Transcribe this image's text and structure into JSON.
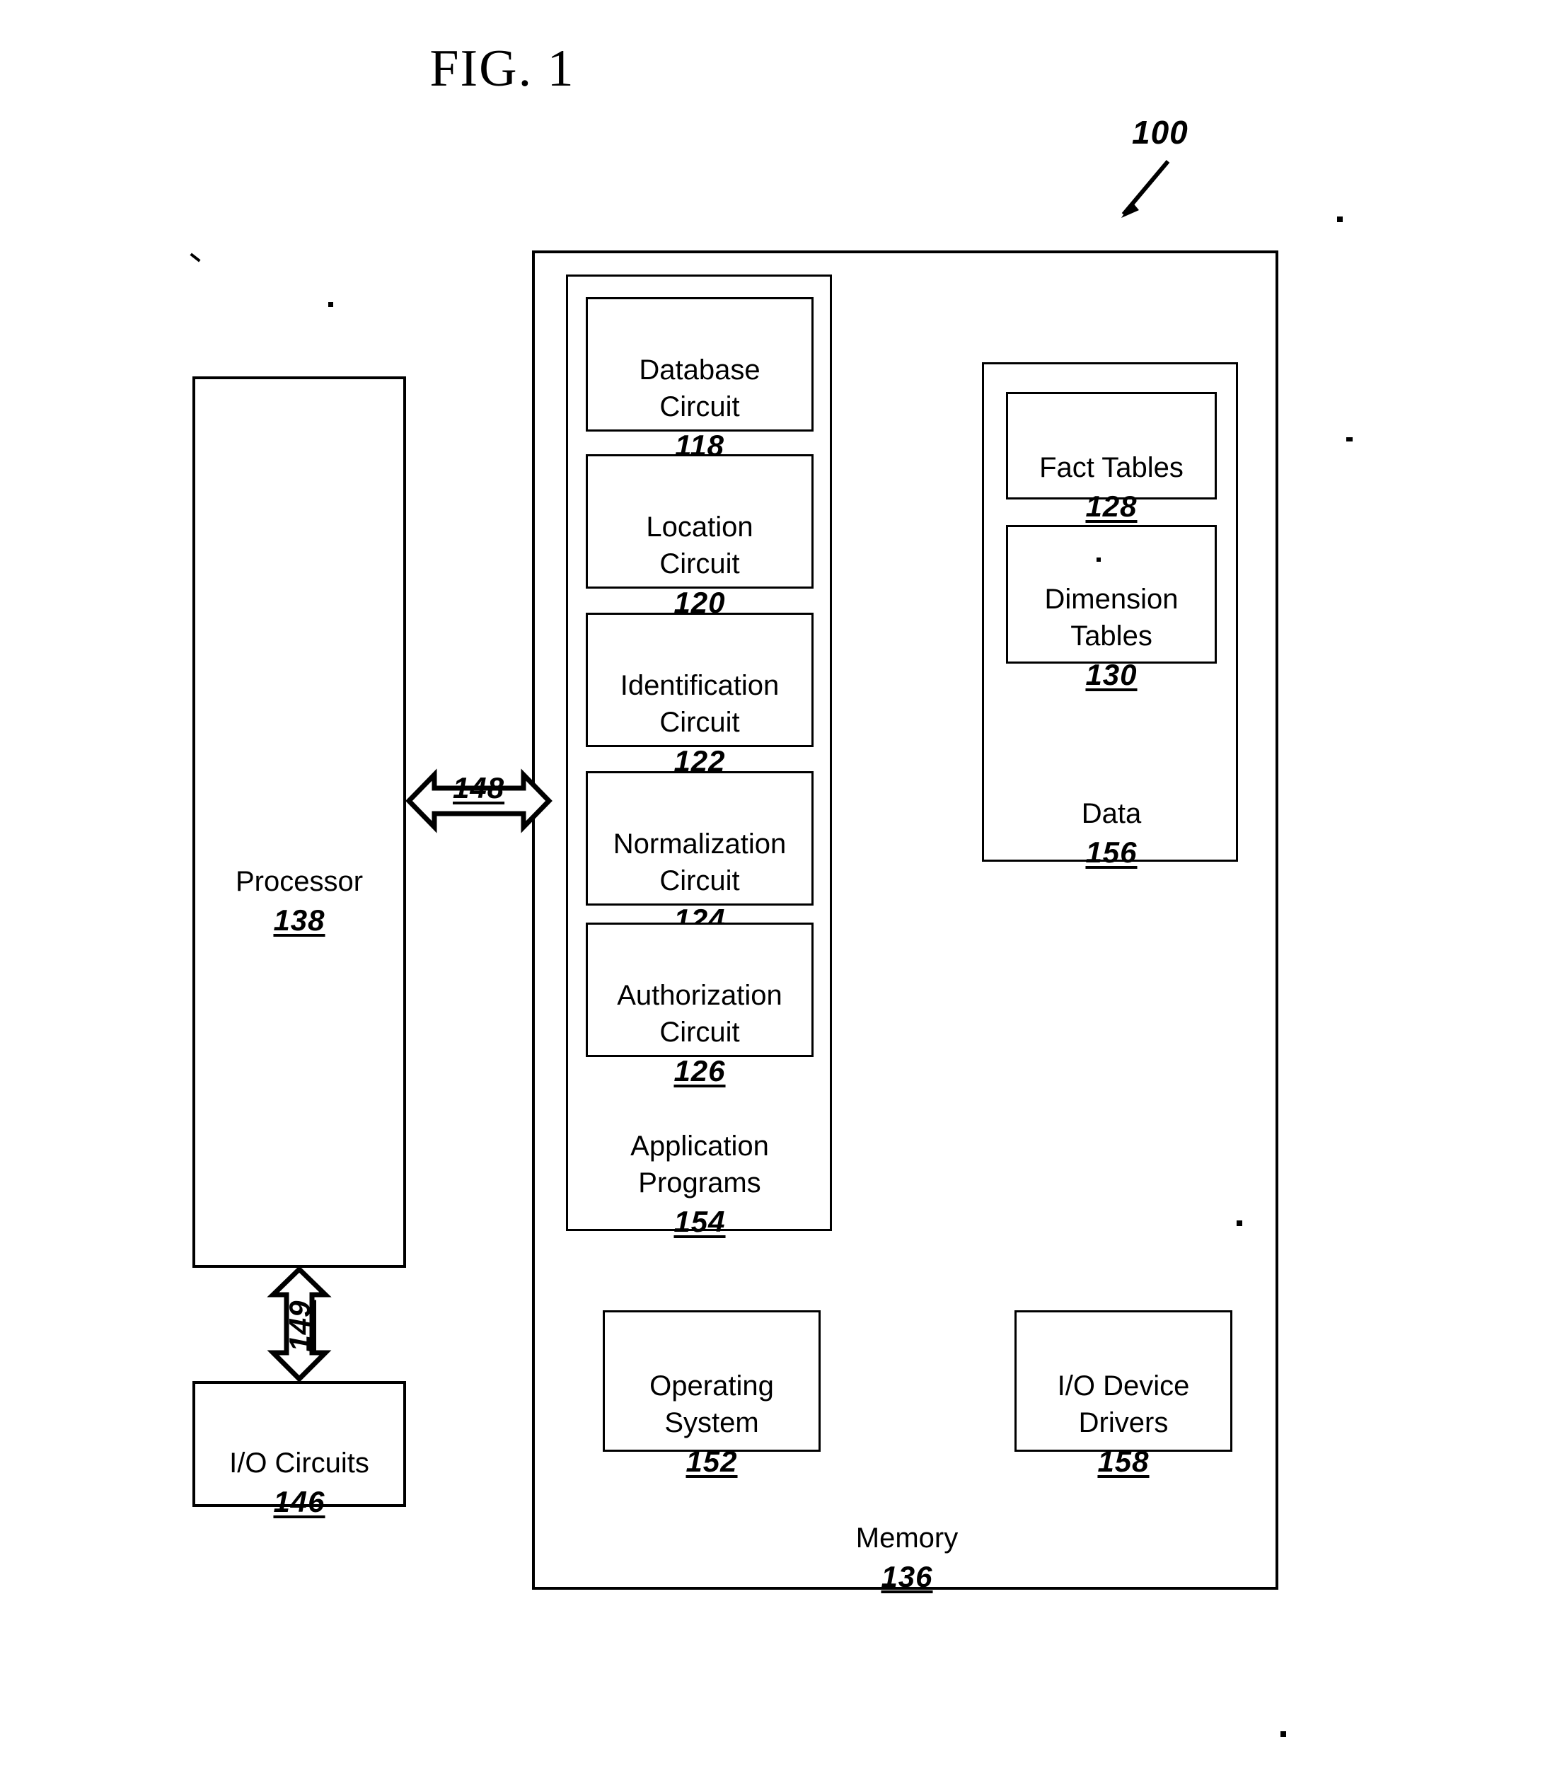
{
  "figure": {
    "title": "FIG. 1",
    "system_ref": "100"
  },
  "processor": {
    "label": "Processor",
    "ref": "138"
  },
  "io_circuits": {
    "label": "I/O Circuits",
    "ref": "146"
  },
  "bus_processor_memory": {
    "ref": "148"
  },
  "bus_processor_io": {
    "ref": "149"
  },
  "memory": {
    "label": "Memory",
    "ref": "136"
  },
  "application_programs": {
    "label": "Application\nPrograms",
    "ref": "154",
    "circuits": [
      {
        "label": "Database\nCircuit",
        "ref": "118"
      },
      {
        "label": "Location\nCircuit",
        "ref": "120"
      },
      {
        "label": "Identification\nCircuit",
        "ref": "122"
      },
      {
        "label": "Normalization\nCircuit",
        "ref": "124"
      },
      {
        "label": "Authorization\nCircuit",
        "ref": "126"
      }
    ]
  },
  "data": {
    "label": "Data",
    "ref": "156",
    "tables": [
      {
        "label": "Fact Tables",
        "ref": "128"
      },
      {
        "label": "Dimension\nTables",
        "ref": "130"
      }
    ]
  },
  "operating_system": {
    "label": "Operating\nSystem",
    "ref": "152"
  },
  "io_device_drivers": {
    "label": "I/O Device\nDrivers",
    "ref": "158"
  }
}
